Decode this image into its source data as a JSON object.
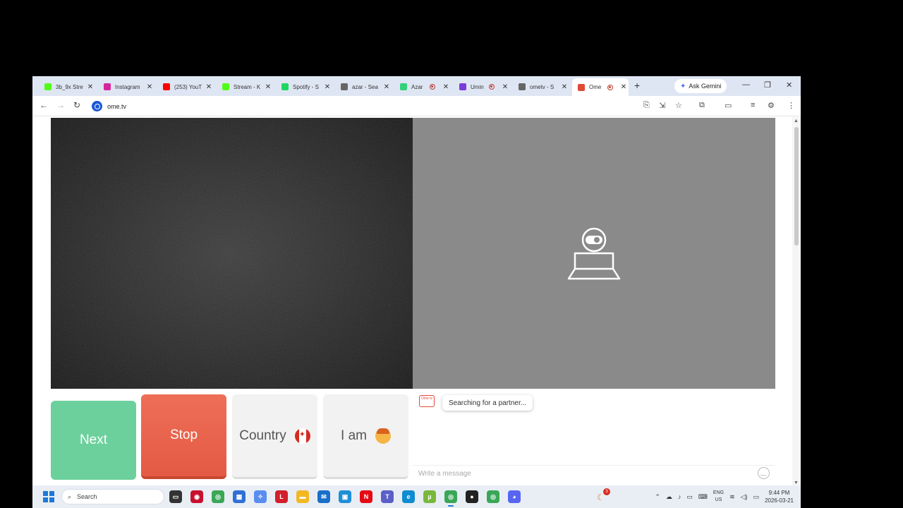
{
  "browser": {
    "tabs": [
      {
        "title": "3b_9x Stre",
        "favicon": "kick-icon",
        "color": "#53fc18",
        "rec": false
      },
      {
        "title": "Instagram",
        "favicon": "instagram-icon",
        "color": "#d6249f",
        "rec": false
      },
      {
        "title": "(253) YouT",
        "favicon": "youtube-icon",
        "color": "#ff0000",
        "rec": false
      },
      {
        "title": "Stream - K",
        "favicon": "kick-icon",
        "color": "#53fc18",
        "rec": false
      },
      {
        "title": "Spotify - S",
        "favicon": "spotify-icon",
        "color": "#1ed760",
        "rec": false
      },
      {
        "title": "azar - Sea",
        "favicon": "search-icon",
        "color": "#666666",
        "rec": false
      },
      {
        "title": "Azar",
        "favicon": "azar-icon",
        "color": "#32d27a",
        "rec": true
      },
      {
        "title": "Umin",
        "favicon": "umingle-icon",
        "color": "#7a3cdb",
        "rec": true
      },
      {
        "title": "ometv - S",
        "favicon": "search-icon",
        "color": "#666666",
        "rec": false
      },
      {
        "title": "Ome",
        "favicon": "ometv-icon",
        "color": "#e04a36",
        "rec": true,
        "active": true
      }
    ],
    "new_tab_label": "+",
    "gemini_label": "Ask Gemini",
    "url": "ome.tv"
  },
  "page": {
    "buttons": {
      "next": "Next",
      "stop": "Stop",
      "country": "Country",
      "iam": "I am"
    },
    "chat": {
      "logo_text": "Ome tv",
      "status": "Searching for a partner...",
      "placeholder": "Write a message"
    }
  },
  "taskbar": {
    "search_label": "Search",
    "lang_line1": "ENG",
    "lang_line2": "US",
    "time": "9:44 PM",
    "date": "2026-03-21",
    "notif_badge": "3",
    "apps": [
      {
        "name": "task-view-icon",
        "color": "#333333",
        "glyph": "▭"
      },
      {
        "name": "app-red-icon",
        "color": "#c8102e",
        "glyph": "◉"
      },
      {
        "name": "chrome-icon",
        "color": "#3aa757",
        "glyph": "◎"
      },
      {
        "name": "store-icon",
        "color": "#2f6fd6",
        "glyph": "▦"
      },
      {
        "name": "copilot-icon",
        "color": "#5a8df0",
        "glyph": "✧"
      },
      {
        "name": "app-l-icon",
        "color": "#d11f2c",
        "glyph": "L"
      },
      {
        "name": "folder-icon",
        "color": "#f2b824",
        "glyph": "▬"
      },
      {
        "name": "outlook-icon",
        "color": "#1a6fc9",
        "glyph": "✉"
      },
      {
        "name": "monitor-icon",
        "color": "#1f8fd6",
        "glyph": "▣"
      },
      {
        "name": "netflix-icon",
        "color": "#e50914",
        "glyph": "N"
      },
      {
        "name": "teams-icon",
        "color": "#5b5fc7",
        "glyph": "T"
      },
      {
        "name": "edge-icon",
        "color": "#0f8bd1",
        "glyph": "e"
      },
      {
        "name": "utorrent-icon",
        "color": "#78b83a",
        "glyph": "µ"
      },
      {
        "name": "chrome-icon",
        "color": "#3aa757",
        "glyph": "◎",
        "active": true
      },
      {
        "name": "obs-icon",
        "color": "#222222",
        "glyph": "●"
      },
      {
        "name": "chrome-icon",
        "color": "#3aa757",
        "glyph": "◎"
      },
      {
        "name": "discord-icon",
        "color": "#5865f2",
        "glyph": "◕"
      }
    ]
  },
  "colors": {
    "next": "#6cd09c",
    "stop": "#e45a44",
    "remote_bg": "#8a8a8a"
  }
}
